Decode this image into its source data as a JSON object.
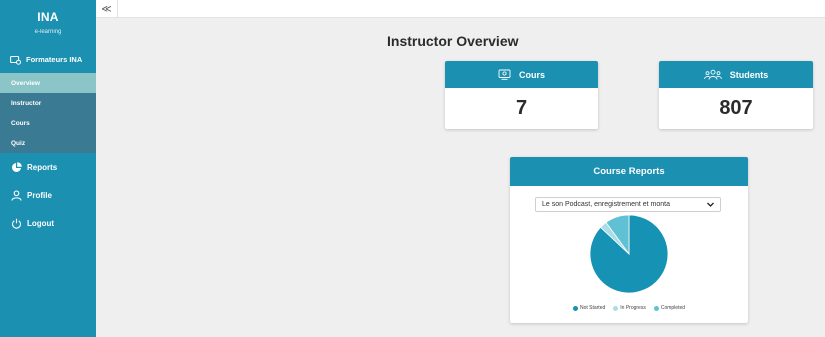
{
  "brand": {
    "title": "INA",
    "subtitle": "e-learning"
  },
  "sidebar": {
    "section_label": "Formateurs INA",
    "sub_items": [
      {
        "label": "Overview",
        "active": true
      },
      {
        "label": "Instructor",
        "active": false
      },
      {
        "label": "Cours",
        "active": false
      },
      {
        "label": "Quiz",
        "active": false
      }
    ],
    "items": [
      {
        "label": "Reports",
        "icon": "pie-chart-icon"
      },
      {
        "label": "Profile",
        "icon": "user-icon"
      },
      {
        "label": "Logout",
        "icon": "power-icon"
      }
    ]
  },
  "topbar": {
    "collapse_glyph": "≪"
  },
  "page": {
    "title": "Instructor Overview"
  },
  "stats": {
    "cours": {
      "label": "Cours",
      "value": "7",
      "icon": "courses-icon"
    },
    "students": {
      "label": "Students",
      "value": "807",
      "icon": "students-icon"
    }
  },
  "reports": {
    "title": "Course Reports",
    "selected_course": "Le son Podcast, enregistrement et monta",
    "legend": [
      {
        "label": "Not Started",
        "color": "#1592b4"
      },
      {
        "label": "In Progress",
        "color": "#a9dde8"
      },
      {
        "label": "Completed",
        "color": "#5fc1d3"
      }
    ]
  },
  "chart_data": {
    "type": "pie",
    "categories": [
      "Not Started",
      "In Progress",
      "Completed"
    ],
    "values": [
      87,
      3,
      10
    ],
    "colors": [
      "#1592b4",
      "#a9dde8",
      "#5fc1d3"
    ]
  },
  "colors": {
    "accent": "#1b90b1",
    "submenu": "#3a7a92",
    "active": "#8cc5c8"
  }
}
